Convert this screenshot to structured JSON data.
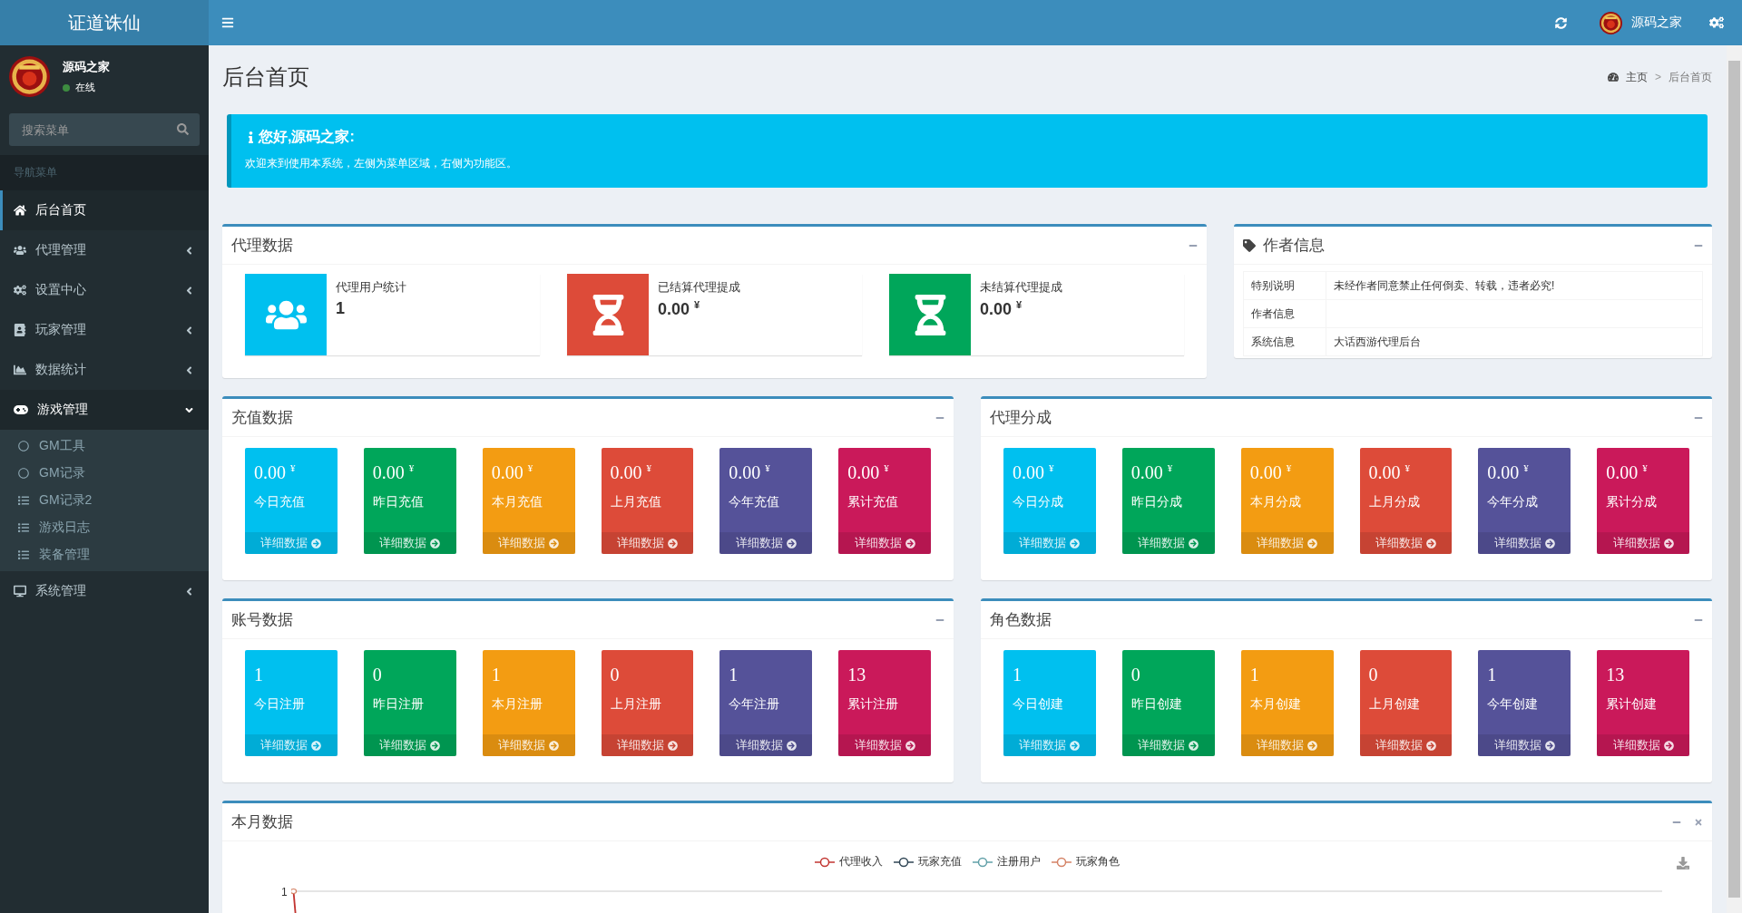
{
  "brand": "证道诛仙",
  "user": {
    "name": "源码之家",
    "status": "在线"
  },
  "search": {
    "placeholder": "搜索菜单"
  },
  "menu_header": "导航菜单",
  "menu": [
    {
      "label": "后台首页",
      "selected": true
    },
    {
      "label": "代理管理",
      "selected": false,
      "expanded": false
    },
    {
      "label": "设置中心",
      "selected": false,
      "expanded": false
    },
    {
      "label": "玩家管理",
      "selected": false,
      "expanded": false
    },
    {
      "label": "数据统计",
      "selected": false,
      "expanded": false
    },
    {
      "label": "游戏管理",
      "selected": false,
      "expanded": true,
      "children": [
        {
          "label": "GM工具",
          "kind": "circle"
        },
        {
          "label": "GM记录",
          "kind": "circle"
        },
        {
          "label": "GM记录2",
          "kind": "list"
        },
        {
          "label": "游戏日志",
          "kind": "list"
        },
        {
          "label": "装备管理",
          "kind": "list"
        }
      ]
    },
    {
      "label": "系统管理",
      "selected": false,
      "expanded": false
    }
  ],
  "navbar": {
    "user_name": "源码之家"
  },
  "page_title": "后台首页",
  "breadcrumb": [
    "主页",
    "后台首页"
  ],
  "breadcrumb_separator": ">",
  "callout": {
    "title": "您好,源码之家:",
    "text": "欢迎来到使用本系统，左侧为菜单区域，右侧为功能区。"
  },
  "agent_panel": {
    "title": "代理数据",
    "items": [
      {
        "label": "代理用户统计",
        "value": "1",
        "color": "#00c0ef"
      },
      {
        "label": "已结算代理提成",
        "value": "0.00",
        "unit": "¥",
        "color": "#dd4b39"
      },
      {
        "label": "未结算代理提成",
        "value": "0.00",
        "unit": "¥",
        "color": "#00a65a"
      }
    ]
  },
  "author_panel": {
    "title": "作者信息",
    "rows": [
      {
        "label": "特别说明",
        "value": "未经作者同意禁止任何倒卖、转载，违者必究!"
      },
      {
        "label": "作者信息"
      },
      {
        "label": "系统信息",
        "value": "大话西游代理后台"
      }
    ]
  },
  "stat_panels": [
    {
      "title": "充值数据",
      "items": [
        {
          "value": "0.00",
          "unit": "¥",
          "label": "今日充值",
          "link": "详细数据",
          "color": "#00c0ef"
        },
        {
          "value": "0.00",
          "unit": "¥",
          "label": "昨日充值",
          "link": "详细数据",
          "color": "#00a65a"
        },
        {
          "value": "0.00",
          "unit": "¥",
          "label": "本月充值",
          "link": "详细数据",
          "color": "#f39c12"
        },
        {
          "value": "0.00",
          "unit": "¥",
          "label": "上月充值",
          "link": "详细数据",
          "color": "#dd4b39"
        },
        {
          "value": "0.00",
          "unit": "¥",
          "label": "今年充值",
          "link": "详细数据",
          "color": "#555299"
        },
        {
          "value": "0.00",
          "unit": "¥",
          "label": "累计充值",
          "link": "详细数据",
          "color": "#ca195a"
        }
      ]
    },
    {
      "title": "代理分成",
      "items": [
        {
          "value": "0.00",
          "unit": "¥",
          "label": "今日分成",
          "link": "详细数据",
          "color": "#00c0ef"
        },
        {
          "value": "0.00",
          "unit": "¥",
          "label": "昨日分成",
          "link": "详细数据",
          "color": "#00a65a"
        },
        {
          "value": "0.00",
          "unit": "¥",
          "label": "本月分成",
          "link": "详细数据",
          "color": "#f39c12"
        },
        {
          "value": "0.00",
          "unit": "¥",
          "label": "上月分成",
          "link": "详细数据",
          "color": "#dd4b39"
        },
        {
          "value": "0.00",
          "unit": "¥",
          "label": "今年分成",
          "link": "详细数据",
          "color": "#555299"
        },
        {
          "value": "0.00",
          "unit": "¥",
          "label": "累计分成",
          "link": "详细数据",
          "color": "#ca195a"
        }
      ]
    },
    {
      "title": "账号数据",
      "items": [
        {
          "value": "1",
          "label": "今日注册",
          "link": "详细数据",
          "color": "#00c0ef"
        },
        {
          "value": "0",
          "label": "昨日注册",
          "link": "详细数据",
          "color": "#00a65a"
        },
        {
          "value": "1",
          "label": "本月注册",
          "link": "详细数据",
          "color": "#f39c12"
        },
        {
          "value": "0",
          "label": "上月注册",
          "link": "详细数据",
          "color": "#dd4b39"
        },
        {
          "value": "1",
          "label": "今年注册",
          "link": "详细数据",
          "color": "#555299"
        },
        {
          "value": "13",
          "label": "累计注册",
          "link": "详细数据",
          "color": "#ca195a"
        }
      ]
    },
    {
      "title": "角色数据",
      "items": [
        {
          "value": "1",
          "label": "今日创建",
          "link": "详细数据",
          "color": "#00c0ef"
        },
        {
          "value": "0",
          "label": "昨日创建",
          "link": "详细数据",
          "color": "#00a65a"
        },
        {
          "value": "1",
          "label": "本月创建",
          "link": "详细数据",
          "color": "#f39c12"
        },
        {
          "value": "0",
          "label": "上月创建",
          "link": "详细数据",
          "color": "#dd4b39"
        },
        {
          "value": "1",
          "label": "今年创建",
          "link": "详细数据",
          "color": "#555299"
        },
        {
          "value": "13",
          "label": "累计创建",
          "link": "详细数据",
          "color": "#ca195a"
        }
      ]
    }
  ],
  "month_panel": {
    "title": "本月数据",
    "legend": [
      {
        "label": "代理收入",
        "color": "#c23531"
      },
      {
        "label": "玩家充值",
        "color": "#2f4554"
      },
      {
        "label": "注册用户",
        "color": "#61a0a8"
      },
      {
        "label": "玩家角色",
        "color": "#d48265"
      }
    ],
    "y_tick": "1"
  }
}
